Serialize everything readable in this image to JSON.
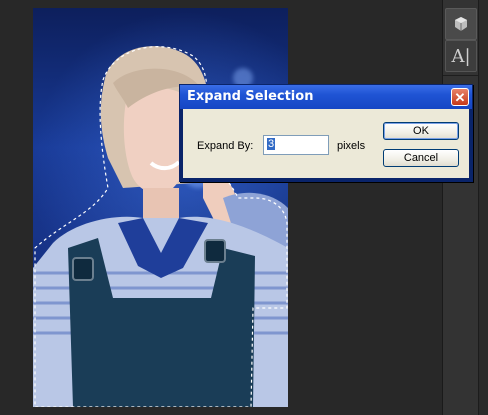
{
  "dialog": {
    "title": "Expand Selection",
    "expand_by_label": "Expand By:",
    "expand_by_value": "3",
    "unit_label": "pixels",
    "ok_label": "OK",
    "cancel_label": "Cancel",
    "close_glyph": "✕"
  },
  "tools": {
    "cube_icon": "3d-cube-icon",
    "text_icon": "character-panel-icon",
    "text_glyph": "A|"
  },
  "colors": {
    "titlebar": "#1f54d4",
    "dialog_body": "#ece9d8",
    "workspace": "#282828",
    "selection_highlight": "#316ac5"
  }
}
